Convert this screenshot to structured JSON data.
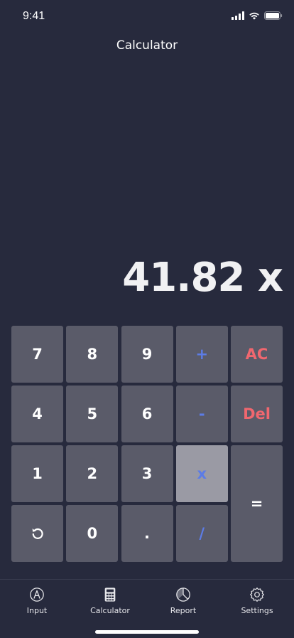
{
  "status": {
    "time": "9:41"
  },
  "header": {
    "title": "Calculator"
  },
  "display": {
    "value": "41.82 x"
  },
  "keypad": {
    "k7": "7",
    "k8": "8",
    "k9": "9",
    "plus": "+",
    "ac": "AC",
    "k4": "4",
    "k5": "5",
    "k6": "6",
    "minus": "-",
    "del": "Del",
    "k1": "1",
    "k2": "2",
    "k3": "3",
    "times": "x",
    "equals": "=",
    "k0": "0",
    "dot": ".",
    "divide": "/"
  },
  "tabs": [
    {
      "label": "Input"
    },
    {
      "label": "Calculator"
    },
    {
      "label": "Report"
    },
    {
      "label": "Settings"
    }
  ],
  "colors": {
    "background": "#272a3d",
    "key": "#5a5b69",
    "key_active": "#9a9aa4",
    "operator": "#5c7ce6",
    "danger": "#f0676f"
  }
}
